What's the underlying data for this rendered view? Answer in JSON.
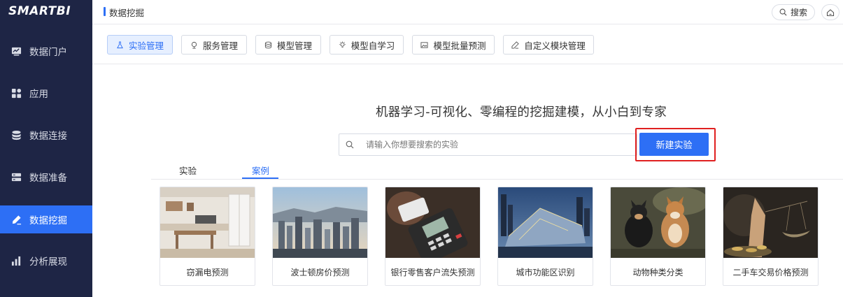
{
  "app": {
    "logo": "SMARTBI"
  },
  "sidebar": {
    "items": [
      {
        "label": "数据门户",
        "icon": "portal-icon"
      },
      {
        "label": "应用",
        "icon": "apps-icon"
      },
      {
        "label": "数据连接",
        "icon": "database-icon"
      },
      {
        "label": "数据准备",
        "icon": "data-prep-icon"
      },
      {
        "label": "数据挖掘",
        "icon": "mining-pen-icon",
        "active": true
      },
      {
        "label": "分析展现",
        "icon": "bar-chart-icon"
      }
    ]
  },
  "header": {
    "breadcrumb": "数据挖掘",
    "search_label": "搜索"
  },
  "toolbar": {
    "tabs": [
      {
        "label": "实验管理",
        "icon": "flask-icon",
        "active": true
      },
      {
        "label": "服务管理",
        "icon": "service-icon"
      },
      {
        "label": "模型管理",
        "icon": "model-icon"
      },
      {
        "label": "模型自学习",
        "icon": "bulb-icon"
      },
      {
        "label": "模型批量预测",
        "icon": "image-icon"
      },
      {
        "label": "自定义模块管理",
        "icon": "custom-pen-icon"
      }
    ]
  },
  "main": {
    "slogan": "机器学习-可视化、零编程的挖掘建模，从小白到专家",
    "search_placeholder": "请输入你想要搜索的实验",
    "new_button": "新建实验",
    "subtabs": [
      {
        "label": "实验"
      },
      {
        "label": "案例",
        "active": true
      }
    ],
    "cases": [
      {
        "title": "窃漏电预测"
      },
      {
        "title": "波士顿房价预测"
      },
      {
        "title": "银行零售客户流失预测"
      },
      {
        "title": "城市功能区识别"
      },
      {
        "title": "动物种类分类"
      },
      {
        "title": "二手车交易价格预测"
      }
    ]
  },
  "colors": {
    "sidebar_bg": "#1e2545",
    "accent": "#2d6ff5",
    "highlight": "#e02020"
  }
}
